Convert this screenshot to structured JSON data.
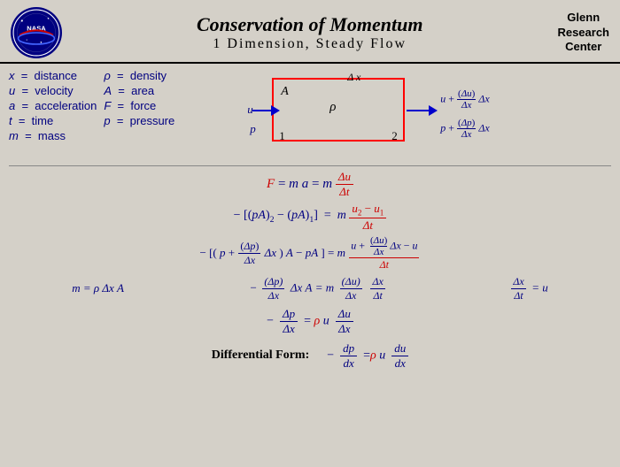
{
  "header": {
    "title1": "Conservation of Momentum",
    "title2": "1  Dimension,  Steady Flow",
    "org": "Glenn\nResearch\nCenter"
  },
  "variables": {
    "col1": [
      {
        "letter": "x",
        "def": "distance"
      },
      {
        "letter": "u",
        "def": "velocity"
      },
      {
        "letter": "a",
        "def": "acceleration"
      },
      {
        "letter": "t",
        "def": "time"
      },
      {
        "letter": "m",
        "def": "mass"
      }
    ],
    "col2": [
      {
        "letter": "ρ",
        "def": "density"
      },
      {
        "letter": "A",
        "def": "area"
      },
      {
        "letter": "F",
        "def": "force"
      },
      {
        "letter": "p",
        "def": "pressure"
      }
    ]
  }
}
